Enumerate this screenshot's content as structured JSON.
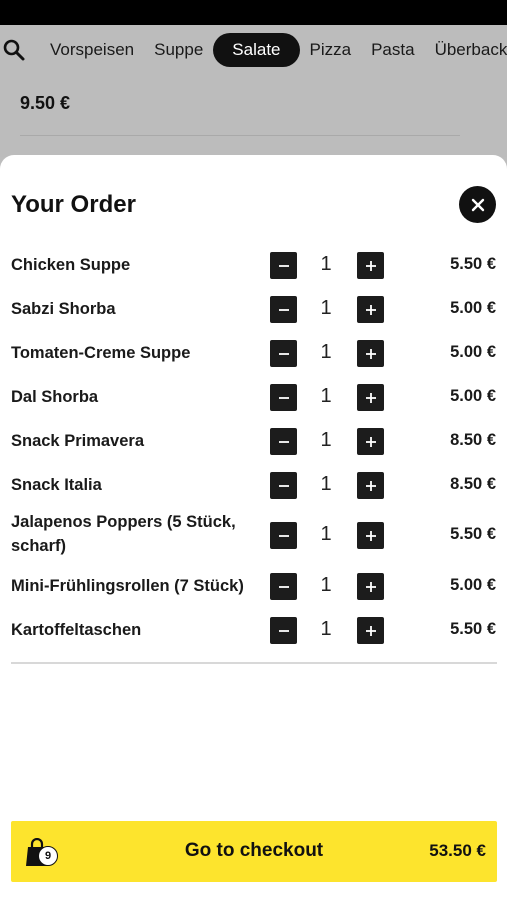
{
  "categories": [
    {
      "label": "Vorspeisen",
      "active": false
    },
    {
      "label": "Suppe",
      "active": false
    },
    {
      "label": "Salate",
      "active": true
    },
    {
      "label": "Pizza",
      "active": false
    },
    {
      "label": "Pasta",
      "active": false
    },
    {
      "label": "Überback",
      "active": false
    }
  ],
  "background": {
    "price": "9.50 €"
  },
  "order": {
    "title": "Your Order",
    "items": [
      {
        "name": "Chicken Suppe",
        "qty": "1",
        "price": "5.50 €"
      },
      {
        "name": "Sabzi Shorba",
        "qty": "1",
        "price": "5.00 €"
      },
      {
        "name": "Tomaten-Creme Suppe",
        "qty": "1",
        "price": "5.00 €"
      },
      {
        "name": "Dal Shorba",
        "qty": "1",
        "price": "5.00 €"
      },
      {
        "name": "Snack Primavera",
        "qty": "1",
        "price": "8.50 €"
      },
      {
        "name": "Snack Italia",
        "qty": "1",
        "price": "8.50 €"
      },
      {
        "name": "Jalapenos Poppers (5 Stück, scharf)",
        "qty": "1",
        "price": "5.50 €"
      },
      {
        "name": "Mini-Frühlingsrollen (7 Stück)",
        "qty": "1",
        "price": "5.00 €"
      },
      {
        "name": "Kartoffeltaschen",
        "qty": "1",
        "price": "5.50 €"
      }
    ]
  },
  "checkout": {
    "label": "Go to checkout",
    "total": "53.50 €",
    "item_count": "9"
  },
  "colors": {
    "accent": "#fde42d",
    "dark": "#111111"
  }
}
